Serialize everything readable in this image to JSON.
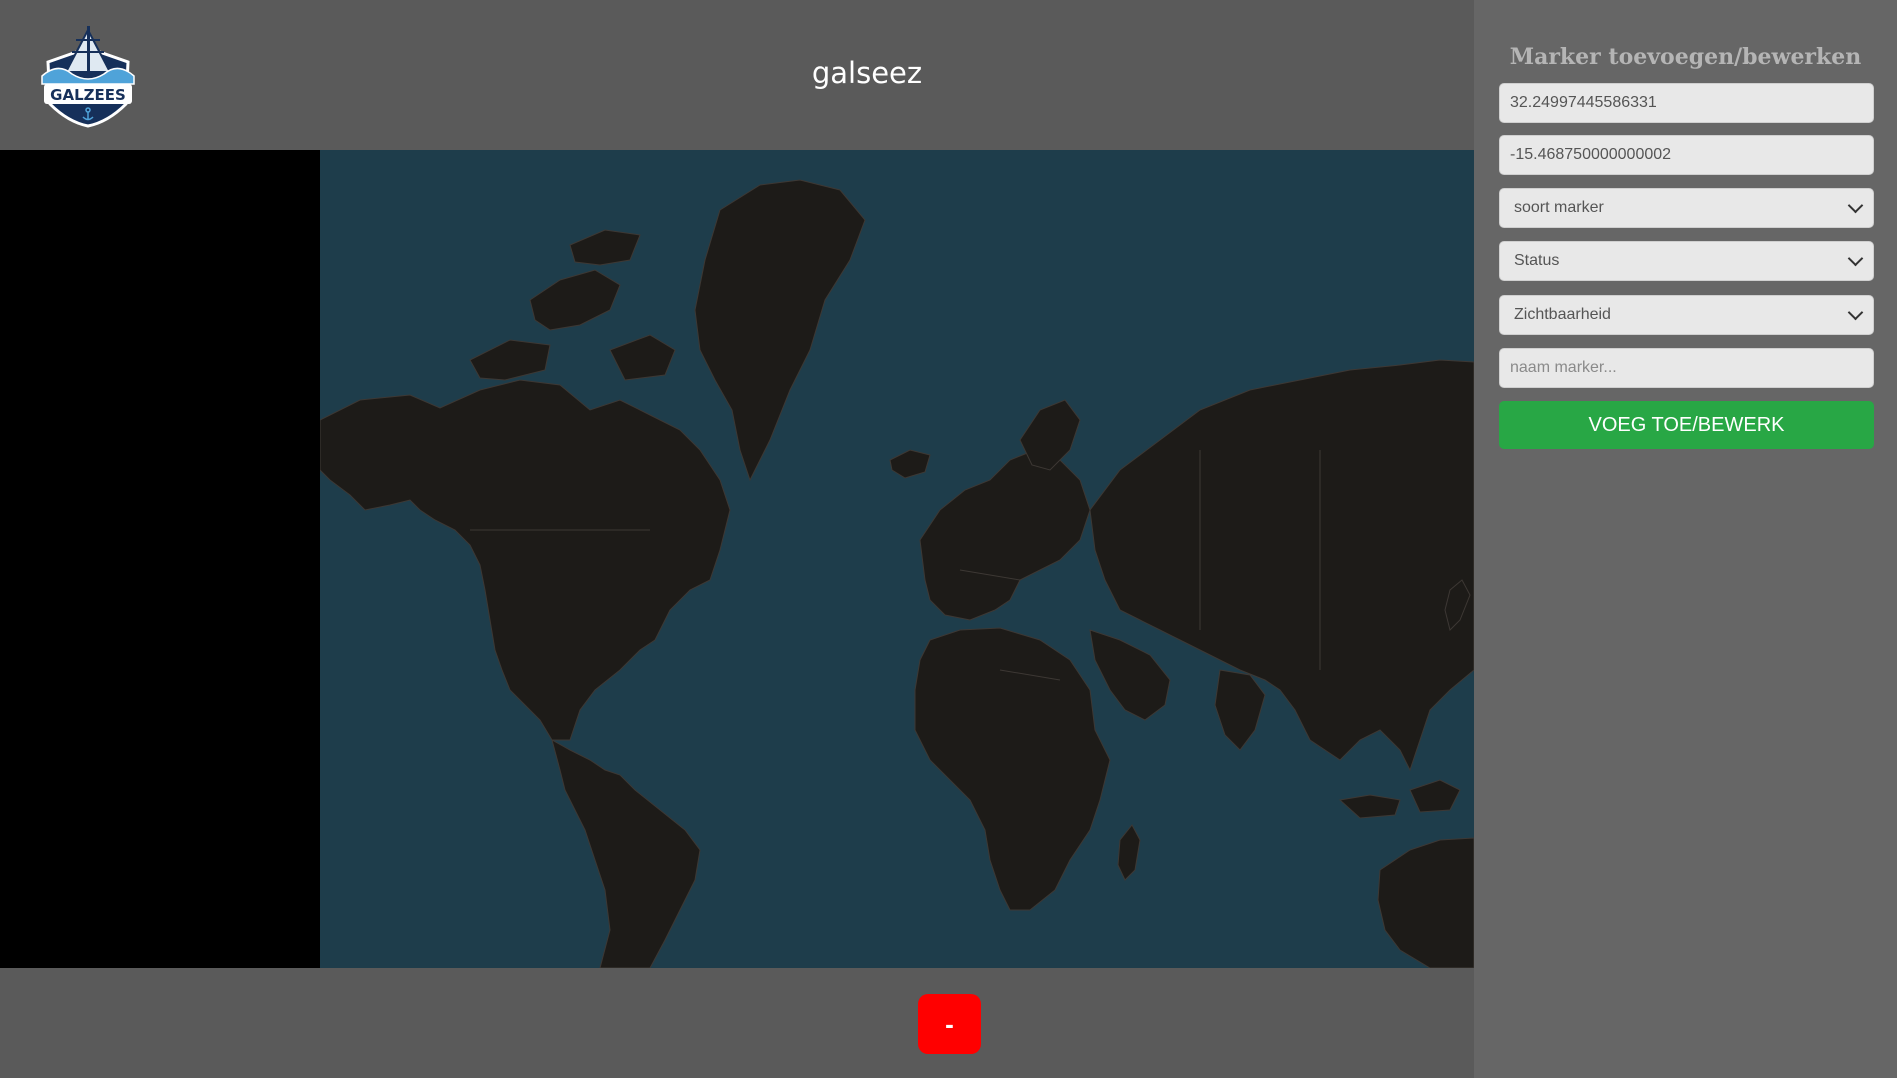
{
  "header": {
    "title": "galseez",
    "logo_text": "GALZEES"
  },
  "map": {
    "description_icon": "world-map",
    "colors": {
      "ocean": "#1e3d4b",
      "land": "#1d1b18"
    }
  },
  "footer": {
    "remove_label": "-"
  },
  "form": {
    "title": "Marker toevoegen/bewerken",
    "latitude_value": "32.24997445586331",
    "longitude_value": "-15.468750000000002",
    "marker_type_selected": "soort marker",
    "status_selected": "Status",
    "visibility_selected": "Zichtbaarheid",
    "name_placeholder": "naam marker...",
    "submit_label": "VOEG TOE/BEWERK"
  },
  "colors": {
    "submit": "#28a745",
    "remove": "#ff0000",
    "sidebar": "#666666",
    "background": "#5a5a5a"
  }
}
